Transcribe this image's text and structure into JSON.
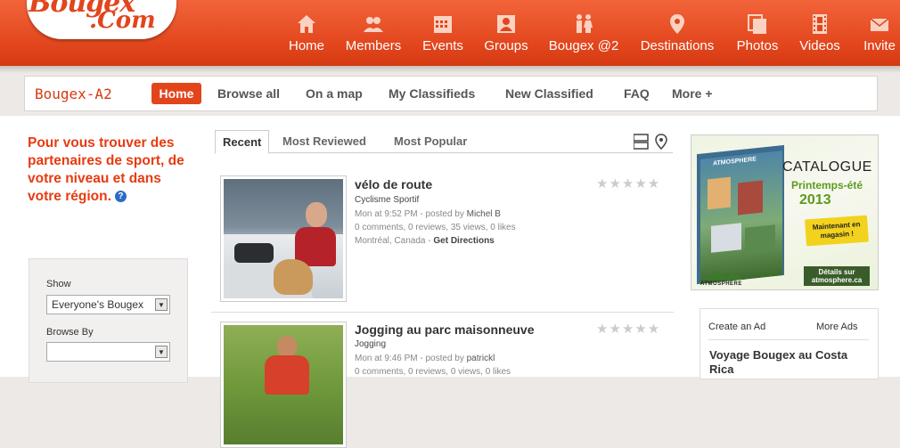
{
  "logo": {
    "line1": "Bougex",
    "line2": "Com"
  },
  "topnav": [
    {
      "label": "Home",
      "icon": "home-icon"
    },
    {
      "label": "Members",
      "icon": "members-icon"
    },
    {
      "label": "Events",
      "icon": "calendar-icon"
    },
    {
      "label": "Groups",
      "icon": "group-icon"
    },
    {
      "label": "Bougex @2",
      "icon": "couple-icon"
    },
    {
      "label": "Destinations",
      "icon": "map-pin-icon"
    },
    {
      "label": "Photos",
      "icon": "photos-icon"
    },
    {
      "label": "Videos",
      "icon": "film-icon"
    },
    {
      "label": "Invite",
      "icon": "mail-icon"
    }
  ],
  "subnav": {
    "brand": "Bougex-A2",
    "home": "Home",
    "links": [
      "Browse all",
      "On a map",
      "My Classifieds",
      "New Classified",
      "FAQ",
      "More +"
    ]
  },
  "intro": {
    "text": "Pour vous trouver des partenaires de sport, de votre niveau et dans votre région.",
    "help": "?"
  },
  "filters": {
    "show_label": "Show",
    "show_value": "Everyone's Bougex",
    "browse_label": "Browse By",
    "browse_value": ""
  },
  "tabs": [
    "Recent",
    "Most Reviewed",
    "Most Popular"
  ],
  "listings": [
    {
      "title": "vélo de route",
      "category": "Cyclisme Sportif",
      "posted": "Mon at 9:52 PM - posted by",
      "author": "Michel B",
      "stats": "0 comments, 0 reviews, 35 views, 0 likes",
      "location": "Montréal, Canada -",
      "directions": "Get Directions",
      "stars": "★★★★★"
    },
    {
      "title": "Jogging au parc maisonneuve",
      "category": "Jogging",
      "posted": "Mon at 9:46 PM - posted by",
      "author": "patrickl",
      "stats": "0 comments, 0 reviews, 0 views, 0 likes",
      "stars": "★★★★★"
    }
  ],
  "ad": {
    "brand": "ATMOSPHERE",
    "catalogue": "CATALOGUE",
    "season": "Printemps-été",
    "year": "2013",
    "badge": "Maintenant en magasin !",
    "details": "Détails sur atmosphere.ca"
  },
  "ads_box": {
    "create": "Create an Ad",
    "more": "More Ads",
    "title": "Voyage Bougex au Costa Rica"
  },
  "colors": {
    "primary": "#e2451c",
    "intro_text": "#e73b10",
    "help_icon": "#2b6cc4"
  }
}
